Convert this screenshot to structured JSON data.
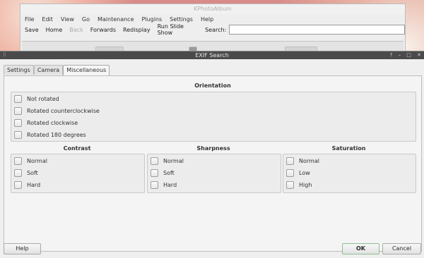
{
  "main_window": {
    "title": "KPhotoAlbum",
    "menu": [
      "File",
      "Edit",
      "View",
      "Go",
      "Maintenance",
      "Plugins",
      "Settings",
      "Help"
    ],
    "toolbar": {
      "save": "Save",
      "home": "Home",
      "back": "Back",
      "forwards": "Forwards",
      "redisplay": "Redisplay",
      "slideshow": "Run Slide Show",
      "search_label": "Search:",
      "search_value": ""
    }
  },
  "dialog": {
    "title": "EXIF Search",
    "window_buttons": [
      "?",
      "–",
      "□",
      "✕"
    ],
    "tabs": [
      "Settings",
      "Camera",
      "Miscellaneous"
    ],
    "active_tab": "Miscellaneous",
    "orientation": {
      "title": "Orientation",
      "options": [
        "Not rotated",
        "Rotated counterclockwise",
        "Rotated clockwise",
        "Rotated 180 degrees"
      ]
    },
    "contrast": {
      "title": "Contrast",
      "options": [
        "Normal",
        "Soft",
        "Hard"
      ]
    },
    "sharpness": {
      "title": "Sharpness",
      "options": [
        "Normal",
        "Soft",
        "Hard"
      ]
    },
    "saturation": {
      "title": "Saturation",
      "options": [
        "Normal",
        "Low",
        "High"
      ]
    },
    "buttons": {
      "help": "Help",
      "ok": "OK",
      "cancel": "Cancel"
    }
  }
}
